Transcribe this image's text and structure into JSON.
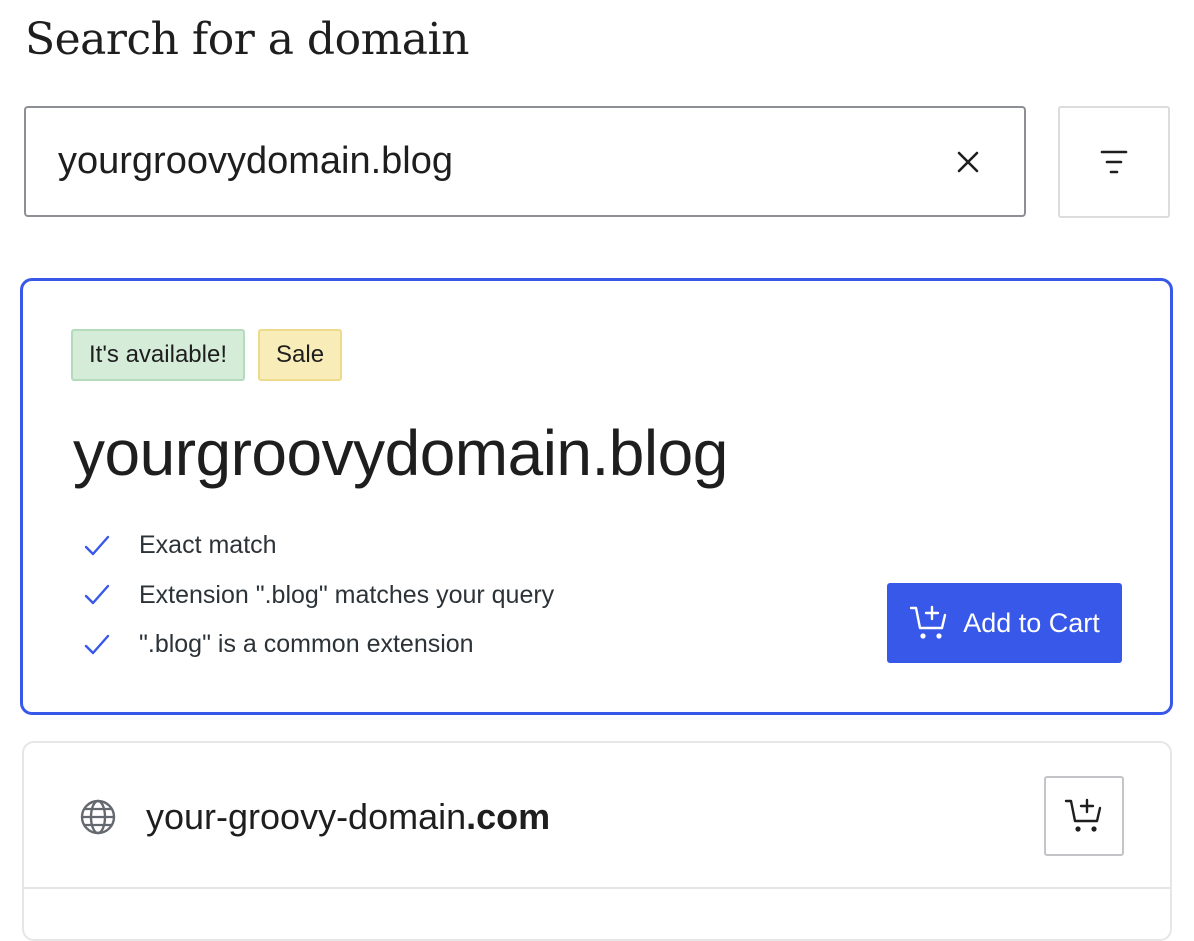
{
  "header": {
    "title": "Search for a domain"
  },
  "search": {
    "value": "yourgroovydomain.blog",
    "clear_icon": "close-icon",
    "filter_icon": "filter-icon"
  },
  "featured": {
    "badges": {
      "available": "It's available!",
      "sale": "Sale"
    },
    "domain": "yourgroovydomain.blog",
    "reasons": [
      "Exact match",
      "Extension \".blog\" matches your query",
      "\".blog\" is a common extension"
    ],
    "add_to_cart_label": "Add to Cart",
    "cart_icon": "cart-plus-icon"
  },
  "results": [
    {
      "name": "your-groovy-domain",
      "tld": ".com",
      "icon": "globe-icon"
    }
  ],
  "colors": {
    "accent": "#3858e9",
    "available_bg": "#d5ecd9",
    "sale_bg": "#f8ecb8",
    "text": "#1e1e1e"
  }
}
